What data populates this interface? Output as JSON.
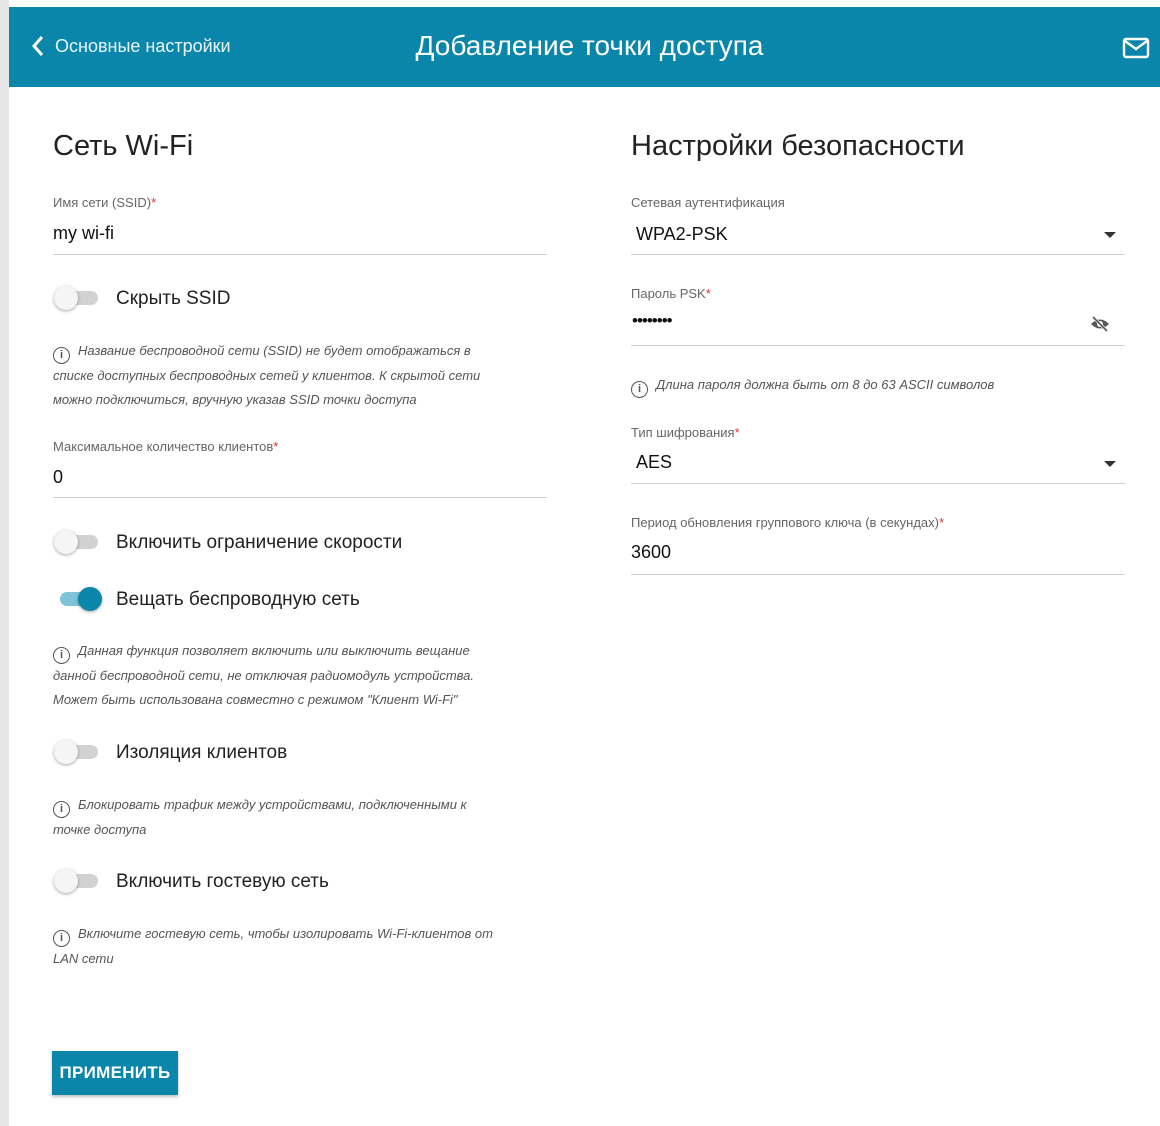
{
  "header": {
    "back_label": "Основные настройки",
    "title": "Добавление точки доступа"
  },
  "wifi": {
    "heading": "Сеть Wi-Fi",
    "ssid_label": "Имя сети (SSID)",
    "ssid_required": "*",
    "ssid_value": "my wi-fi",
    "hide_ssid": {
      "label": "Скрыть SSID",
      "on": false
    },
    "hide_ssid_hint": [
      "Название беспроводной сети (SSID) не будет отображаться в",
      "списке доступных беспроводных сетей у клиентов. К скрытой сети",
      "можно подключиться, вручную указав SSID точки доступа"
    ],
    "max_clients_label": "Максимальное количество клиентов",
    "max_clients_required": "*",
    "max_clients_value": "0",
    "speed_limit": {
      "label": "Включить ограничение скорости",
      "on": false
    },
    "broadcast": {
      "label": "Вещать беспроводную сеть",
      "on": true
    },
    "broadcast_hint": [
      "Данная функция позволяет включить или выключить вещание",
      "данной беспроводной сети, не отключая радиомодуль устройства.",
      "Может быть использована совместно с режимом \"Клиент Wi-Fi\""
    ],
    "isolation": {
      "label": "Изоляция клиентов",
      "on": false
    },
    "isolation_hint": [
      "Блокировать трафик между устройствами, подключенными к",
      "точке доступа"
    ],
    "guest": {
      "label": "Включить гостевую сеть",
      "on": false
    },
    "guest_hint": [
      "Включите гостевую сеть, чтобы изолировать Wi-Fi-клиентов от",
      "LAN сети"
    ]
  },
  "security": {
    "heading": "Настройки безопасности",
    "auth_label": "Сетевая аутентификация",
    "auth_value": "WPA2-PSK",
    "psk_label": "Пароль PSK",
    "psk_required": "*",
    "psk_value": "••••••••",
    "psk_hint": "Длина пароля должна быть от 8 до 63 ASCII символов",
    "cipher_label": "Тип шифрования",
    "cipher_required": "*",
    "cipher_value": "AES",
    "group_key_label": "Период обновления группового ключа (в секундах)",
    "group_key_required": "*",
    "group_key_value": "3600"
  },
  "apply_label": "ПРИМЕНИТЬ"
}
